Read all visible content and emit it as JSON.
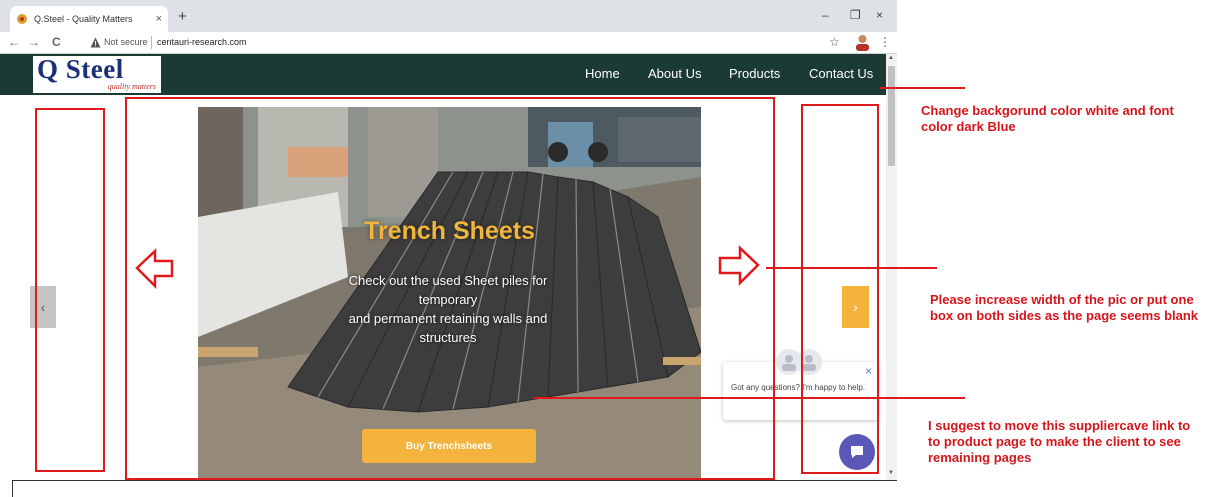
{
  "browser": {
    "tab_title": "Q.Steel - Quality Matters",
    "tab_close": "×",
    "new_tab": "+",
    "minimize": "–",
    "maximize": "❐",
    "close": "×",
    "back": "←",
    "forward": "→",
    "reload": "C",
    "security_label": "Not secure",
    "url": "centauri-research.com",
    "bookmark": "☆",
    "menu": "⋮"
  },
  "site": {
    "logo_text": "Q Steel",
    "logo_tagline": "quality matters",
    "nav": [
      "Home",
      "About Us",
      "Products",
      "Contact Us"
    ],
    "hero": {
      "title": "Trench Sheets",
      "description_line1": "Check out the used Sheet piles for temporary",
      "description_line2": "and permanent retaining walls and structures",
      "cta": "Buy Trenchsheets"
    },
    "carousel_prev": "‹",
    "carousel_next": "›",
    "chat": {
      "message": "Got any questions? I'm happy to help.",
      "close": "×"
    }
  },
  "annotations": {
    "note1": "Change backgorund color white and font color dark Blue",
    "note2": "Please increase width of the pic or put one box on both sides as the page seems blank",
    "note3": "I suggest to move this suppliercave link to to product page to make the client to see remaining pages",
    "color": "#d6151b"
  }
}
